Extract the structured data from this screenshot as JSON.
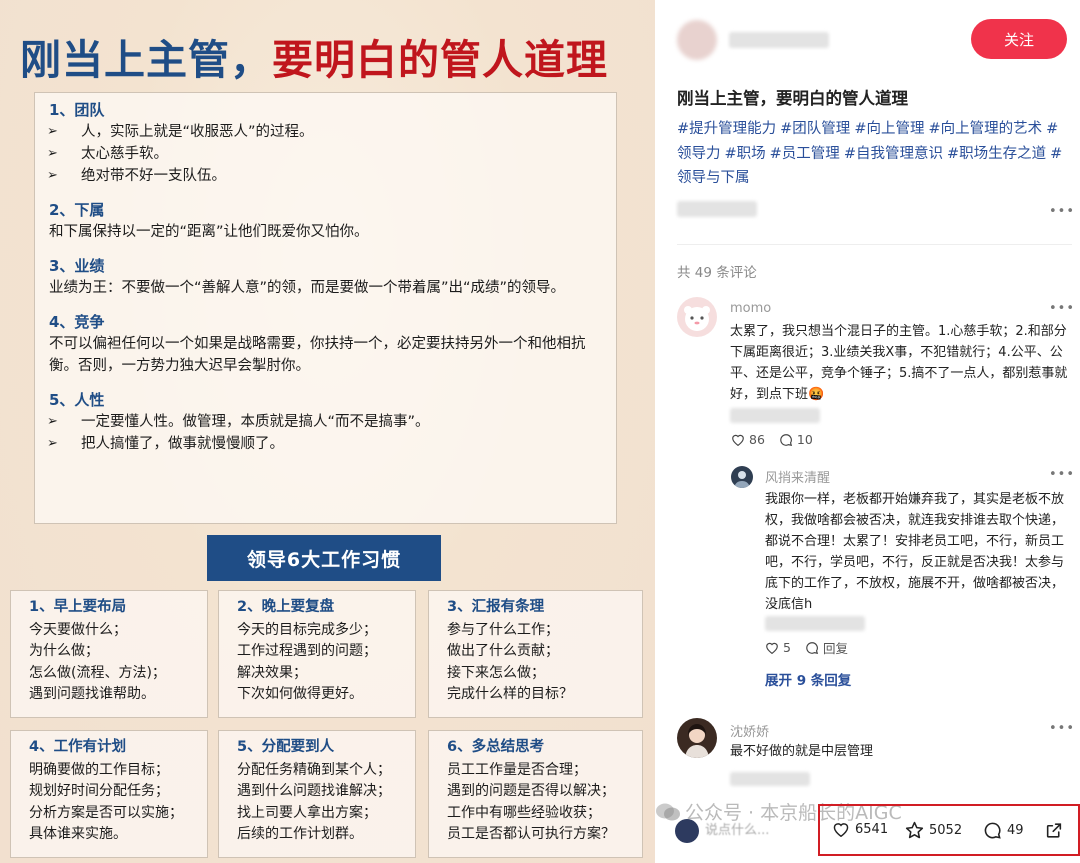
{
  "poster": {
    "title_part1": "刚当上主管，",
    "title_part2": "要明白的管人道理",
    "sections": [
      {
        "head": "1、团队",
        "bullets": [
          "人，实际上就是“收服恶人”的过程。",
          "太心慈手软。",
          "绝对带不好一支队伍。"
        ]
      },
      {
        "head": "2、下属",
        "text": "和下属保持以一定的“距离”让他们既爱你又怕你。"
      },
      {
        "head": "3、业绩",
        "text": "业绩为王：不要做一个“善解人意”的领，而是要做一个带着属”出“成绩”的领导。"
      },
      {
        "head": "4、竞争",
        "text": "不可以偏袒任何以一个如果是战略需要，你扶持一个，必定要扶持另外一个和他相抗衡。否则，一方势力独大迟早会掣肘你。"
      },
      {
        "head": "5、人性",
        "bullets": [
          "一定要懂人性。做管理，本质就是搞人“而不是搞事”。",
          "把人搞懂了，做事就慢慢顺了。"
        ]
      }
    ],
    "habits_banner": "领导6大工作习惯",
    "habits": [
      {
        "title": "1、早上要布局",
        "lines": [
          "今天要做什么；",
          "为什么做；",
          "怎么做(流程、方法)；",
          "遇到问题找谁帮助。"
        ]
      },
      {
        "title": "2、晚上要复盘",
        "lines": [
          "今天的目标完成多少；",
          "工作过程遇到的问题；",
          "解决效果；",
          "下次如何做得更好。"
        ]
      },
      {
        "title": "3、汇报有条理",
        "lines": [
          "参与了什么工作；",
          "做出了什么贡献；",
          "接下来怎么做；",
          "完成什么样的目标？"
        ]
      },
      {
        "title": "4、工作有计划",
        "lines": [
          "明确要做的工作目标；",
          "规划好时间分配任务；",
          "分析方案是否可以实施；",
          "具体谁来实施。"
        ]
      },
      {
        "title": "5、分配要到人",
        "lines": [
          "分配任务精确到某个人；",
          "遇到什么问题找谁解决；",
          "找上司要人拿出方案；",
          "后续的工作计划群。"
        ]
      },
      {
        "title": "6、多总结思考",
        "lines": [
          "员工工作量是否合理；",
          "遇到的问题是否得以解决；",
          "工作中有哪些经验收获；",
          "员工是否都认可执行方案？"
        ]
      }
    ]
  },
  "post": {
    "follow_label": "关注",
    "title": "刚当上主管，要明白的管人道理",
    "tags": [
      "#提升管理能力",
      "#团队管理",
      "#向上管理",
      "#向上管理的艺术",
      "#领导力",
      "#职场",
      "#员工管理",
      "#自我管理意识",
      "#职场生存之道",
      "#领导与下属"
    ],
    "comment_count": "共 49 条评论"
  },
  "comments": [
    {
      "name": "momo",
      "text": "太累了，我只想当个混日子的主管。1.心慈手软；2.和部分下属距离很近；3.业绩关我X事，不犯错就行；4.公平、公平、还是公平，竞争个锤子；5.搞不了一点人，都别惹事就好，到点下班🤬",
      "likes": "86",
      "replies": "10"
    },
    {
      "name": "风捎来清醒",
      "text": "我跟你一样，老板都开始嫌弃我了，其实是老板不放权，我做啥都会被否决，就连我安排谁去取个快递，都说不合理！太累了！安排老员工吧，不行，新员工吧，不行，学员吧，不行，反正就是否决我！太参与底下的工作了，不放权，施展不开，做啥都被否决，没底信h",
      "likes": "5",
      "reply_label": "回复"
    },
    {
      "name": "沈娇娇",
      "text": "最不好做的就是中层管理"
    }
  ],
  "expand_replies": "展开 9 条回复",
  "bottom_bar": {
    "input_placeholder": "说点什么...",
    "likes": "6541",
    "favorites": "5052",
    "comments": "49"
  },
  "watermark": "公众号 · 本京船长的AIGC",
  "colors": {
    "accent_red": "#f0334b",
    "tag_blue": "#2a4f9a",
    "poster_blue": "#1f4d86",
    "poster_red": "#c0161d",
    "highlight": "#d11d24"
  }
}
